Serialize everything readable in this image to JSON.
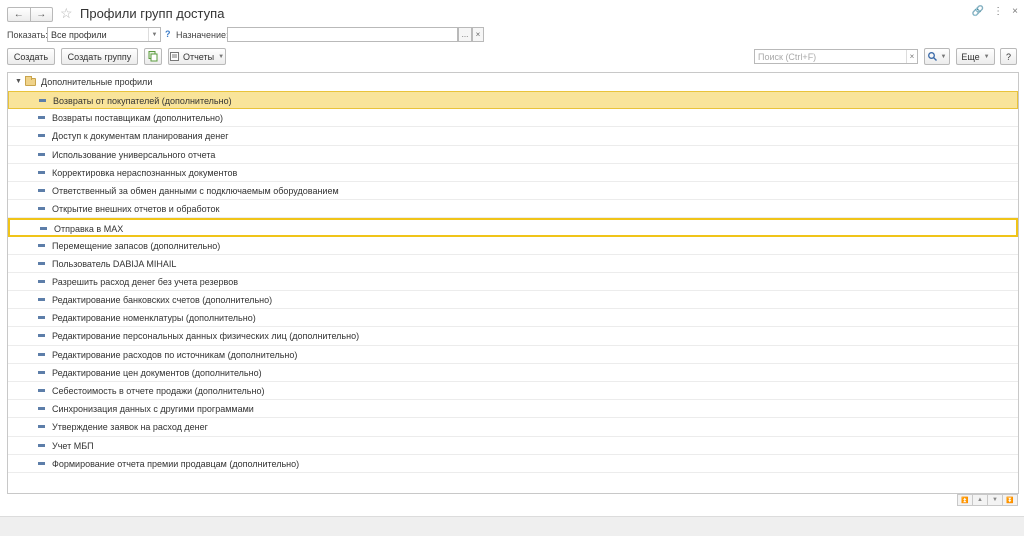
{
  "window": {
    "title": "Профили групп доступа",
    "nav_back": "←",
    "nav_forward": "→",
    "star": "☆",
    "icon_link": "🔗",
    "icon_menu": "⋮",
    "icon_close": "×"
  },
  "filters": {
    "show_label": "Показать:",
    "show_value": "Все профили",
    "show_help": "?",
    "purpose_label": "Назначение:",
    "purpose_value": "",
    "ellipsis": "...",
    "clear": "×",
    "dropdown": "▼"
  },
  "toolbar": {
    "create": "Создать",
    "create_group": "Создать группу",
    "reports": "Отчеты",
    "search_placeholder": "Поиск (Ctrl+F)",
    "search_clear": "×",
    "search_icon": "🔍",
    "more": "Еще",
    "help": "?"
  },
  "tree": {
    "root_label": "Дополнительные профили",
    "root_expander": "▼",
    "items": [
      "Возвраты от покупателей (дополнительно)",
      "Возвраты поставщикам (дополнительно)",
      "Доступ к документам планирования денег",
      "Использование универсального отчета",
      "Корректировка нераспознанных документов",
      "Ответственный за обмен данными с подключаемым оборудованием",
      "Открытие внешних отчетов и обработок",
      "Отправка в MAX",
      "Перемещение запасов (дополнительно)",
      "Пользователь DABIJA MIHAIL",
      "Разрешить расход денег без учета резервов",
      "Редактирование банковских счетов (дополнительно)",
      "Редактирование номенклатуры (дополнительно)",
      "Редактирование персональных данных физических лиц (дополнительно)",
      "Редактирование расходов по источникам (дополнительно)",
      "Редактирование цен документов (дополнительно)",
      "Себестоимость в отчете продажи (дополнительно)",
      "Синхронизация данных с другими программами",
      "Утверждение заявок на расход денег",
      "Учет МБП",
      "Формирование отчета премии продавцам (дополнительно)"
    ],
    "selected_index": 0,
    "focused_index": 7
  },
  "bottom_nav": {
    "first": "⏫",
    "up": "▲",
    "down": "▼",
    "last": "⏬"
  },
  "colors": {
    "selected_row": "#f9e49a",
    "focus_border": "#f0c419",
    "item_marker": "#5d7ea9"
  }
}
